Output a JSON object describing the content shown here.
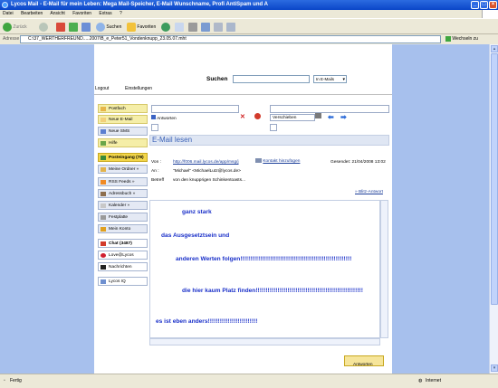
{
  "browser": {
    "title": "Lycos Mail - E-Mail für mein Leben: Mega Mail-Speicher, E-Mail Wunschname, Profi AntiSpam und A",
    "menu": [
      "Datei",
      "Bearbeiten",
      "Ansicht",
      "Favoriten",
      "Extras",
      "?"
    ],
    "toolbar": {
      "back": "Zurück",
      "search": "Suchen",
      "favorites": "Favoriten"
    },
    "address_label": "Adresse",
    "address": "C:\\37_WERTHERFREUND.....2007\\B_e_Peter51_Vondenknupp_23.05.07.mht",
    "go": "Wechseln zu",
    "status_left": "Fertig",
    "status_right": "Internet"
  },
  "header": {
    "search_label": "Suchen",
    "search_scope": "In E-Mails",
    "logout": "Logout",
    "settings": "Einstellungen"
  },
  "sidebar": {
    "items": [
      {
        "label": "Postfach",
        "style": "y"
      },
      {
        "label": "Neue E-Mail",
        "style": "y"
      },
      {
        "label": "Neue SMS",
        "style": "n"
      },
      {
        "label": "Hilfe",
        "style": "y"
      },
      {
        "label": "Posteingang (78)",
        "style": "b"
      },
      {
        "label": "Meine Ordner »",
        "style": "n"
      },
      {
        "label": "RSS Feeds »",
        "style": "n"
      },
      {
        "label": "Adressbuch »",
        "style": "n"
      },
      {
        "label": "Kalender »",
        "style": "n"
      },
      {
        "label": "Festplatte",
        "style": "n"
      },
      {
        "label": "Mein Konto",
        "style": "n"
      },
      {
        "label": "Chat (3487)",
        "style": "n"
      },
      {
        "label": "Love@Lycos",
        "style": "n"
      },
      {
        "label": "Nachrichten",
        "style": "n"
      },
      {
        "label": "Lycos IQ",
        "style": "n"
      }
    ]
  },
  "toolbar": {
    "reply": "Antworten",
    "move": "Verschieben"
  },
  "mail": {
    "title": "E-Mail lesen",
    "from_label": "Von :",
    "from": "http://f006.mail.lycos.de/app/msg/j",
    "add_contact": "Kontakt hinzufügen",
    "sent": "Gesendet: 21/04/2008 13:02",
    "to_label": "An :",
    "to": "\"Michael\" <MichaelLutz@lycos.de>",
    "subject_label": "Betreff",
    "subject": "von den knupprigen Schinkentoasts...",
    "quick_reply": "» Blitz-Antwort",
    "body": [
      "ganz stark",
      "das Ausgesetztsein und",
      "anderen Werten folgen!!!!!!!!!!!!!!!!!!!!!!!!!!!!!!!!!!!!!!!!!!!!!!!!!!!!!!!!",
      "die hier kaum Platz finden!!!!!!!!!!!!!!!!!!!!!!!!!!!!!!!!!!!!!!!!!!!!!!!!!!!!!!",
      "es ist eben anders!!!!!!!!!!!!!!!!!!!!!!!!!"
    ],
    "reply_bottom": "Antworten"
  }
}
